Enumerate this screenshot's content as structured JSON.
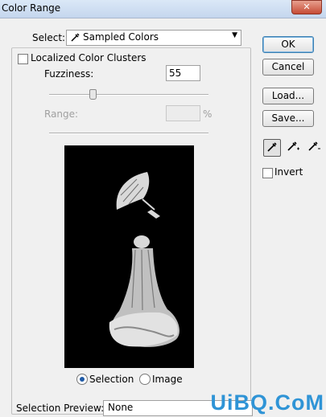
{
  "window": {
    "title": "Color Range",
    "close_symbol": "✕"
  },
  "select": {
    "label": "Select:",
    "value": "Sampled Colors"
  },
  "localized": {
    "label": "Localized Color Clusters",
    "checked": false
  },
  "fuzziness": {
    "label": "Fuzziness:",
    "value": "55"
  },
  "range": {
    "label": "Range:",
    "value": "",
    "unit": "%"
  },
  "view": {
    "selection_label": "Selection",
    "image_label": "Image",
    "selected": "Selection"
  },
  "preview_select": {
    "label": "Selection Preview:",
    "value": "None"
  },
  "buttons": {
    "ok": "OK",
    "cancel": "Cancel",
    "load": "Load...",
    "save": "Save..."
  },
  "invert": {
    "label": "Invert",
    "checked": false
  },
  "tools": [
    "eyedropper-icon",
    "eyedropper-plus-icon",
    "eyedropper-minus-icon"
  ],
  "watermark": "UiBQ.CoM"
}
